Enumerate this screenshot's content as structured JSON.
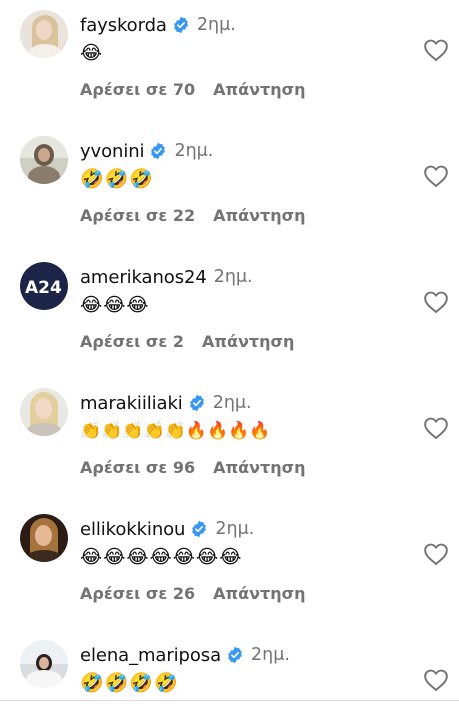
{
  "colors": {
    "verified": "#3897f0",
    "secondary_text": "#737373"
  },
  "comments": [
    {
      "username": "fayskorda",
      "verified": true,
      "time": "2ημ.",
      "emojis": "😂",
      "likes": "Αρέσει σε 70",
      "reply": "Απάντηση",
      "avatar_icon": "blonde-woman-avatar"
    },
    {
      "username": "yvonini",
      "verified": true,
      "time": "2ημ.",
      "emojis": "🤣🤣🤣",
      "likes": "Αρέσει σε 22",
      "reply": "Απάντηση",
      "avatar_icon": "woman-avatar"
    },
    {
      "username": "amerikanos24",
      "verified": false,
      "time": "2ημ.",
      "emojis": "😂😂😂",
      "likes": "Αρέσει σε 2",
      "reply": "Απάντηση",
      "avatar_icon": "a24-logo-avatar",
      "avatar_text": "A24"
    },
    {
      "username": "marakiiliaki",
      "verified": true,
      "time": "2ημ.",
      "emojis": "👏👏👏👏👏🔥🔥🔥🔥",
      "likes": "Αρέσει σε 96",
      "reply": "Απάντηση",
      "avatar_icon": "blonde-woman-avatar"
    },
    {
      "username": "ellikokkinou",
      "verified": true,
      "time": "2ημ.",
      "emojis": "😂😂😂😂😂😂😂",
      "likes": "Αρέσει σε 26",
      "reply": "Απάντηση",
      "avatar_icon": "woman-avatar"
    },
    {
      "username": "elena_mariposa",
      "verified": true,
      "time": "2ημ.",
      "emojis": "🤣🤣🤣🤣",
      "likes": "",
      "reply": "",
      "avatar_icon": "woman-avatar"
    }
  ]
}
